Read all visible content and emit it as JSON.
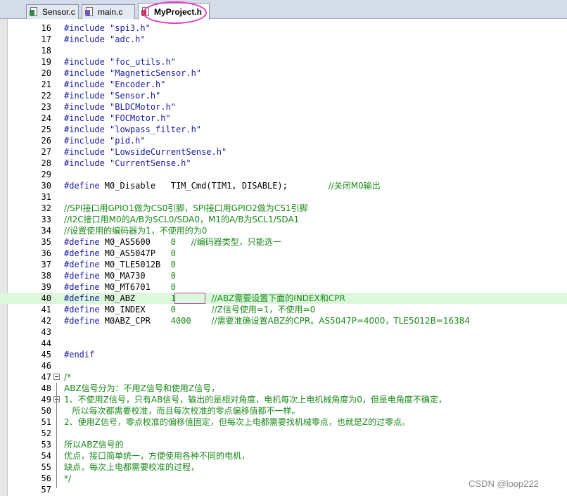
{
  "tabs": [
    {
      "label": "Sensor.c",
      "icon": "c-file-icon",
      "active": false
    },
    {
      "label": "main.c",
      "icon": "c-file-icon",
      "active": false
    },
    {
      "label": "MyProject.h",
      "icon": "header-file-icon",
      "active": true
    }
  ],
  "lines": [
    {
      "n": "16",
      "segs": [
        [
          "pp",
          "#include "
        ],
        [
          "str",
          "\"spi3.h\""
        ]
      ]
    },
    {
      "n": "17",
      "segs": [
        [
          "pp",
          "#include "
        ],
        [
          "str",
          "\"adc.h\""
        ]
      ]
    },
    {
      "n": "18",
      "segs": []
    },
    {
      "n": "19",
      "segs": [
        [
          "pp",
          "#include "
        ],
        [
          "str",
          "\"foc_utils.h\""
        ]
      ]
    },
    {
      "n": "20",
      "segs": [
        [
          "pp",
          "#include "
        ],
        [
          "str",
          "\"MagneticSensor.h\""
        ]
      ]
    },
    {
      "n": "21",
      "segs": [
        [
          "pp",
          "#include "
        ],
        [
          "str",
          "\"Encoder.h\""
        ]
      ]
    },
    {
      "n": "22",
      "segs": [
        [
          "pp",
          "#include "
        ],
        [
          "str",
          "\"Sensor.h\""
        ]
      ]
    },
    {
      "n": "23",
      "segs": [
        [
          "pp",
          "#include "
        ],
        [
          "str",
          "\"BLDCMotor.h\""
        ]
      ]
    },
    {
      "n": "24",
      "segs": [
        [
          "pp",
          "#include "
        ],
        [
          "str",
          "\"FOCMotor.h\""
        ]
      ]
    },
    {
      "n": "25",
      "segs": [
        [
          "pp",
          "#include "
        ],
        [
          "str",
          "\"lowpass_filter.h\""
        ]
      ]
    },
    {
      "n": "26",
      "segs": [
        [
          "pp",
          "#include "
        ],
        [
          "str",
          "\"pid.h\""
        ]
      ]
    },
    {
      "n": "27",
      "segs": [
        [
          "pp",
          "#include "
        ],
        [
          "str",
          "\"LowsideCurrentSense.h\""
        ]
      ]
    },
    {
      "n": "28",
      "segs": [
        [
          "pp",
          "#include "
        ],
        [
          "str",
          "\"CurrentSense.h\""
        ]
      ]
    },
    {
      "n": "29",
      "segs": []
    },
    {
      "n": "30",
      "segs": [
        [
          "pp",
          "#define "
        ],
        [
          "txt",
          "M0_Disable   TIM_Cmd(TIM1, DISABLE);        "
        ],
        [
          "cmt",
          "//关闭M0输出"
        ]
      ]
    },
    {
      "n": "31",
      "segs": []
    },
    {
      "n": "32",
      "segs": [
        [
          "cmt",
          "//SPI接口用GPIO1做为CS0引脚，SPI接口用GPIO2做为CS1引脚"
        ]
      ]
    },
    {
      "n": "33",
      "segs": [
        [
          "cmt",
          "//I2C接口用M0的A/B为SCL0/SDA0，M1的A/B为SCL1/SDA1"
        ]
      ]
    },
    {
      "n": "34",
      "segs": [
        [
          "cmt",
          "//设置使用的编码器为1，不使用的为0"
        ]
      ]
    },
    {
      "n": "35",
      "segs": [
        [
          "pp",
          "#define "
        ],
        [
          "txt",
          "M0_AS5600    "
        ],
        [
          "num",
          "0"
        ],
        [
          "txt",
          "   "
        ],
        [
          "cmt",
          "//编码器类型，只能选一"
        ]
      ]
    },
    {
      "n": "36",
      "segs": [
        [
          "pp",
          "#define "
        ],
        [
          "txt",
          "M0_AS5047P   "
        ],
        [
          "num",
          "0"
        ]
      ]
    },
    {
      "n": "37",
      "segs": [
        [
          "pp",
          "#define "
        ],
        [
          "txt",
          "M0_TLE5012B  "
        ],
        [
          "num",
          "0"
        ]
      ]
    },
    {
      "n": "38",
      "segs": [
        [
          "pp",
          "#define "
        ],
        [
          "txt",
          "M0_MA730     "
        ],
        [
          "num",
          "0"
        ]
      ]
    },
    {
      "n": "39",
      "segs": [
        [
          "pp",
          "#define "
        ],
        [
          "txt",
          "M0_MT6701    "
        ],
        [
          "num",
          "0"
        ]
      ]
    },
    {
      "n": "40",
      "segs": [
        [
          "pp",
          "#define "
        ],
        [
          "txt",
          "M0_ABZ       "
        ],
        [
          "num",
          "1"
        ],
        [
          "txt",
          "       "
        ],
        [
          "cmt",
          "//ABZ需要设置下面的INDEX和CPR"
        ]
      ],
      "hl": true
    },
    {
      "n": "41",
      "segs": [
        [
          "pp",
          "#define "
        ],
        [
          "txt",
          "M0_INDEX     "
        ],
        [
          "num",
          "0"
        ],
        [
          "txt",
          "       "
        ],
        [
          "cmt",
          "//Z信号使用=1，不使用=0"
        ]
      ]
    },
    {
      "n": "42",
      "segs": [
        [
          "pp",
          "#define "
        ],
        [
          "txt",
          "M0ABZ_CPR    "
        ],
        [
          "num",
          "4000"
        ],
        [
          "txt",
          "    "
        ],
        [
          "cmt",
          "//需要准确设置ABZ的CPR。AS5047P=4000，TLE5012B=16384"
        ]
      ]
    },
    {
      "n": "43",
      "segs": []
    },
    {
      "n": "44",
      "segs": []
    },
    {
      "n": "45",
      "segs": [
        [
          "pp",
          "#endif"
        ]
      ]
    },
    {
      "n": "46",
      "segs": []
    },
    {
      "n": "47",
      "segs": [
        [
          "cmt",
          "/*"
        ]
      ],
      "fold": true
    },
    {
      "n": "48",
      "segs": [
        [
          "cmt",
          "ABZ信号分为：不用Z信号和使用Z信号，"
        ]
      ]
    },
    {
      "n": "49",
      "segs": [
        [
          "cmt",
          "1、不使用Z信号，只有AB信号，输出的是相对角度，电机每次上电机械角度为0，但是电角度不确定，"
        ]
      ],
      "fold": true
    },
    {
      "n": "50",
      "segs": [
        [
          "cmt",
          "   所以每次都需要校准，而且每次校准的零点偏移值都不一样。"
        ]
      ]
    },
    {
      "n": "51",
      "segs": [
        [
          "cmt",
          "2、使用Z信号，零点校准的偏移值固定，但每次上电都需要找机械零点，也就是Z的过零点。"
        ]
      ]
    },
    {
      "n": "52",
      "segs": []
    },
    {
      "n": "53",
      "segs": [
        [
          "cmt",
          "所以ABZ信号的"
        ]
      ]
    },
    {
      "n": "54",
      "segs": [
        [
          "cmt",
          "优点，接口简单统一，方便使用各种不同的电机，"
        ]
      ]
    },
    {
      "n": "55",
      "segs": [
        [
          "cmt",
          "缺点，每次上电都需要校准的过程，"
        ]
      ]
    },
    {
      "n": "56",
      "segs": [
        [
          "cmt",
          "*/"
        ]
      ]
    },
    {
      "n": "57",
      "segs": []
    }
  ],
  "watermark": "CSDN @loop222"
}
